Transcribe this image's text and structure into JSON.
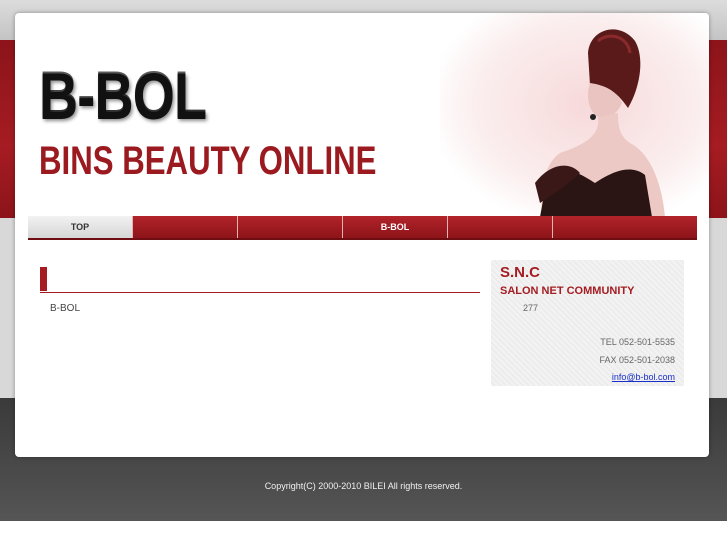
{
  "header": {
    "logo": "B-BOL",
    "tagline": "BINS BEAUTY ONLINE"
  },
  "nav": {
    "items": [
      {
        "label": "TOP"
      },
      {
        "label": ""
      },
      {
        "label": ""
      },
      {
        "label": "B-BOL"
      },
      {
        "label": ""
      },
      {
        "label": ""
      }
    ]
  },
  "main": {
    "heading": "",
    "body": "B-BOL"
  },
  "sidebar": {
    "title": "S.N.C",
    "subtitle": "SALON NET COMMUNITY",
    "number": "277",
    "tel": "TEL 052-501-5535",
    "fax": "FAX 052-501-2038",
    "email": "info@b-bol.com"
  },
  "footer": {
    "copyright": "Copyright(C) 2000-2010 BILEI All rights reserved."
  },
  "colors": {
    "brand_red": "#a51c22",
    "dark_gray": "#4a4a4a"
  }
}
